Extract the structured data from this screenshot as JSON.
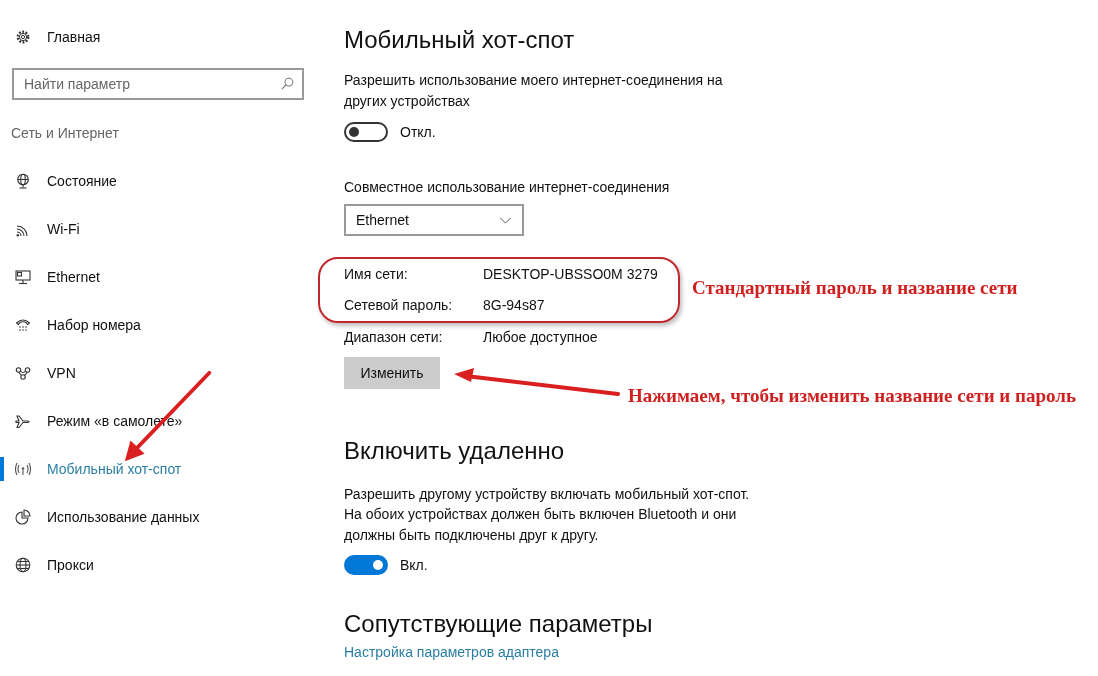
{
  "sidebar": {
    "home": "Главная",
    "search": {
      "placeholder": "Найти параметр"
    },
    "section": "Сеть и Интернет",
    "items": [
      {
        "label": "Состояние",
        "selected": false
      },
      {
        "label": "Wi-Fi",
        "selected": false
      },
      {
        "label": "Ethernet",
        "selected": false
      },
      {
        "label": "Набор номера",
        "selected": false
      },
      {
        "label": "VPN",
        "selected": false
      },
      {
        "label": "Режим «в самолете»",
        "selected": false
      },
      {
        "label": "Мобильный хот-спот",
        "selected": true
      },
      {
        "label": "Использование данных",
        "selected": false
      },
      {
        "label": "Прокси",
        "selected": false
      }
    ]
  },
  "page": {
    "title": "Мобильный хот-спот",
    "share": {
      "description": "Разрешить использование моего интернет-соединения на других устройствах",
      "toggle": {
        "on": false,
        "label": "Откл."
      }
    },
    "share_from": {
      "label": "Совместное использование интернет-соединения",
      "value": "Ethernet"
    },
    "properties": [
      {
        "label": "Имя сети:",
        "value": "DESKTOP-UBSSO0M 3279"
      },
      {
        "label": "Сетевой пароль:",
        "value": "8G-94s87"
      },
      {
        "label": "Диапазон сети:",
        "value": "Любое доступное"
      }
    ],
    "edit_button": "Изменить",
    "remote": {
      "heading": "Включить удаленно",
      "description": "Разрешить другому устройству включать мобильный хот-спот. На обоих устройствах должен быть включен Bluetooth и они должны быть подключены друг к другу.",
      "toggle": {
        "on": true,
        "label": "Вкл."
      }
    },
    "related": {
      "heading": "Сопутствующие параметры",
      "link": "Настройка параметров адаптера"
    }
  },
  "annotations": [
    {
      "text": "Стандартный пароль и название сети"
    },
    {
      "text": "Нажимаем, чтобы изменить название сети и пароль"
    }
  ]
}
